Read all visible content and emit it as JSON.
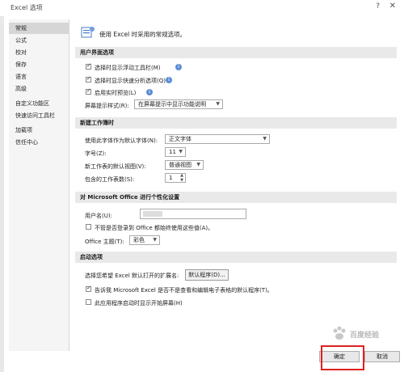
{
  "window": {
    "title": "Excel 选项",
    "help": "?",
    "close": "✕"
  },
  "sidebar": {
    "items": [
      {
        "label": "常规",
        "active": true
      },
      {
        "label": "公式"
      },
      {
        "label": "校对"
      },
      {
        "label": "保存"
      },
      {
        "label": "语言"
      },
      {
        "label": "高级"
      },
      {
        "label": "自定义功能区"
      },
      {
        "label": "快速访问工具栏"
      },
      {
        "label": "加载项"
      },
      {
        "label": "信任中心"
      }
    ]
  },
  "header": {
    "text": "使用 Excel 时采用的常规选项。"
  },
  "sections": {
    "ui": {
      "title": "用户界面选项",
      "mini_toolbar": "选择时显示浮动工具栏(M)",
      "quick_analysis": "选择时显示快速分析选项(Q)",
      "live_preview": "启用实时预览(L)",
      "screentip_label": "屏幕提示样式(R):",
      "screentip_value": "在屏幕提示中显示功能说明"
    },
    "new_workbook": {
      "title": "新建工作簿时",
      "font_label": "使用此字体作为默认字体(N):",
      "font_value": "正文字体",
      "size_label": "字号(Z):",
      "size_value": "11",
      "view_label": "新工作表的默认视图(V):",
      "view_value": "普通视图",
      "sheets_label": "包含的工作表数(S):",
      "sheets_value": "1"
    },
    "personalize": {
      "title": "对 Microsoft Office 进行个性化设置",
      "username_label": "用户名(U):",
      "always_use": "不管是否登录到 Office 都始终使用这些值(A)。",
      "theme_label": "Office 主题(T):",
      "theme_value": "彩色"
    },
    "startup": {
      "title": "启动选项",
      "ext_label": "选择您希望 Excel 默认打开的扩展名:",
      "default_programs_button": "默认程序(D)...",
      "tell_me": "告诉我 Microsoft Excel 是否不是查看和编辑电子表格的默认程序(T)。",
      "show_start": "此应用程序启动时显示开始屏幕(H)"
    }
  },
  "footer": {
    "ok": "确定",
    "cancel": "取消"
  },
  "watermark": {
    "text": "百度经验"
  },
  "colors": {
    "highlight": "#e02020",
    "info": "#5b8dd6"
  }
}
